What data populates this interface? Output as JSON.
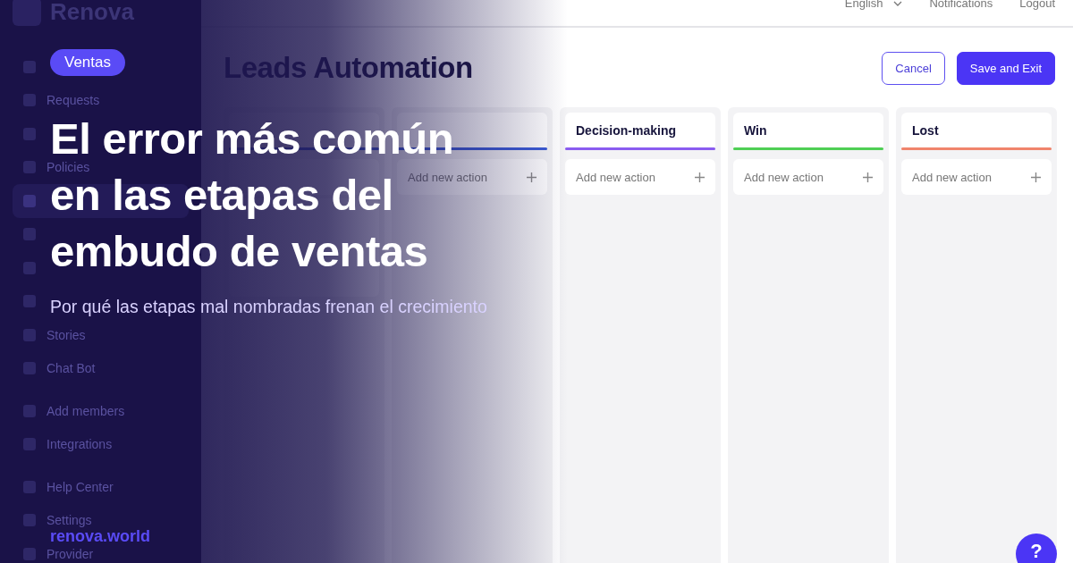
{
  "sidebar": {
    "logo": "Renova",
    "items": [
      {
        "kind": "icon",
        "selected": false
      },
      {
        "kind": "link",
        "label": "Requests",
        "selected": false
      },
      {
        "kind": "icon",
        "selected": false
      },
      {
        "kind": "link",
        "label": "Policies",
        "selected": false
      },
      {
        "kind": "icon",
        "selected": true
      },
      {
        "kind": "icon",
        "selected": false
      },
      {
        "kind": "icon",
        "selected": false
      },
      {
        "kind": "icon",
        "selected": false
      },
      {
        "kind": "link",
        "label": "Stories",
        "selected": false
      },
      {
        "kind": "link",
        "label": "Chat Bot",
        "selected": false
      },
      {
        "kind": "link",
        "label": "Add members",
        "selected": false
      },
      {
        "kind": "link",
        "label": "Integrations",
        "selected": false
      },
      {
        "kind": "link",
        "label": "Help Center",
        "selected": false
      },
      {
        "kind": "link",
        "label": "Settings",
        "selected": false
      },
      {
        "kind": "link",
        "label": "Provider",
        "selected": false
      }
    ]
  },
  "topbar": {
    "language": "English",
    "links": [
      "Notifications",
      "Logout"
    ]
  },
  "page": {
    "title": "Leads Automation",
    "buttons": [
      {
        "label": "Cancel",
        "kind": "secondary"
      },
      {
        "label": "Save and Exit",
        "kind": "primary"
      }
    ]
  },
  "board": {
    "columns": [
      {},
      {
        "action": "Add new action"
      },
      {
        "title": "Decision-making",
        "color": "#8a5cf0",
        "action": "Add new action"
      },
      {
        "title": "Win",
        "color": "#4fcf55",
        "action": "Add new action"
      },
      {
        "title": "Lost",
        "color": "#f0846c",
        "action": "Add new action"
      }
    ]
  },
  "help_button": "?",
  "overlay": {
    "tag": "Ventas",
    "headline": [
      "El error más común",
      "en las etapas del",
      "embudo de ventas"
    ],
    "subtitle": "Por qué las etapas mal nombradas frenan el crecimiento",
    "site": "renova.world"
  }
}
